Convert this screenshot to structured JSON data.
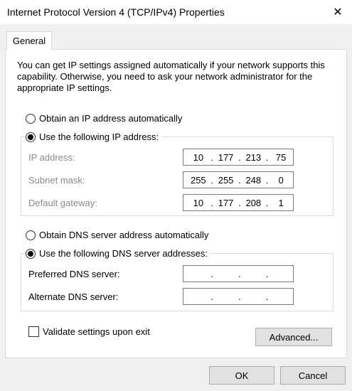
{
  "window": {
    "title": "Internet Protocol Version 4 (TCP/IPv4) Properties",
    "close_glyph": "✕"
  },
  "tabs": [
    {
      "label": "General",
      "selected": true
    }
  ],
  "intro_text": "You can get IP settings assigned automatically if your network supports this capability. Otherwise, you need to ask your network administrator for the appropriate IP settings.",
  "ip_section": {
    "auto_label": "Obtain an IP address automatically",
    "auto_selected": false,
    "manual_label": "Use the following IP address:",
    "manual_selected": true,
    "fields": [
      {
        "label": "IP address:",
        "octets": [
          "10",
          "177",
          "213",
          "75"
        ]
      },
      {
        "label": "Subnet mask:",
        "octets": [
          "255",
          "255",
          "248",
          "0"
        ]
      },
      {
        "label": "Default gateway:",
        "octets": [
          "10",
          "177",
          "208",
          "1"
        ]
      }
    ]
  },
  "dns_section": {
    "auto_label": "Obtain DNS server address automatically",
    "auto_selected": false,
    "manual_label": "Use the following DNS server addresses:",
    "manual_selected": true,
    "fields": [
      {
        "label": "Preferred DNS server:",
        "octets": [
          "",
          "",
          "",
          ""
        ]
      },
      {
        "label": "Alternate DNS server:",
        "octets": [
          "",
          "",
          "",
          ""
        ]
      }
    ]
  },
  "validate": {
    "label": "Validate settings upon exit",
    "checked": false
  },
  "buttons": {
    "advanced": "Advanced...",
    "ok": "OK",
    "cancel": "Cancel"
  }
}
